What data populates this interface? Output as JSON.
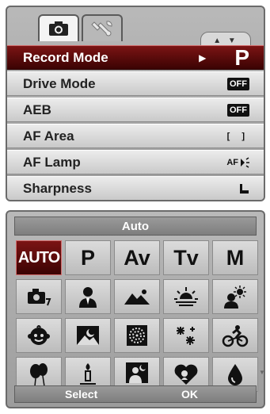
{
  "tabs": [
    {
      "name": "camera",
      "icon": "camera-icon"
    },
    {
      "name": "setup",
      "icon": "wrench-icon"
    }
  ],
  "menu_scroll": "▲ ▼",
  "menu": [
    {
      "label": "Record Mode",
      "value": "P",
      "selected": true
    },
    {
      "label": "Drive Mode",
      "value": "OFF"
    },
    {
      "label": "AEB",
      "value": "OFF"
    },
    {
      "label": "AF Area",
      "value": "[ ]"
    },
    {
      "label": "AF Lamp",
      "value": "AF"
    },
    {
      "label": "Sharpness",
      "value": "sharpness-icon"
    }
  ],
  "mode_panel": {
    "title": "Auto",
    "text_modes": [
      "AUTO",
      "P",
      "Av",
      "Tv",
      "M"
    ],
    "scene_icons": [
      "scene-camera-icon",
      "portrait-icon",
      "landscape-icon",
      "sunset-icon",
      "backlight-icon",
      "kids-icon",
      "night-scene-icon",
      "fireworks-icon",
      "snow-icon",
      "sports-icon",
      "party-icon",
      "candlelight-icon",
      "night-portrait-icon",
      "soft-skin-icon",
      "water-icon"
    ],
    "footer": {
      "select": "Select",
      "ok": "OK"
    }
  },
  "colors": {
    "selected": "#5a0909",
    "panel": "#a8a8a8"
  }
}
